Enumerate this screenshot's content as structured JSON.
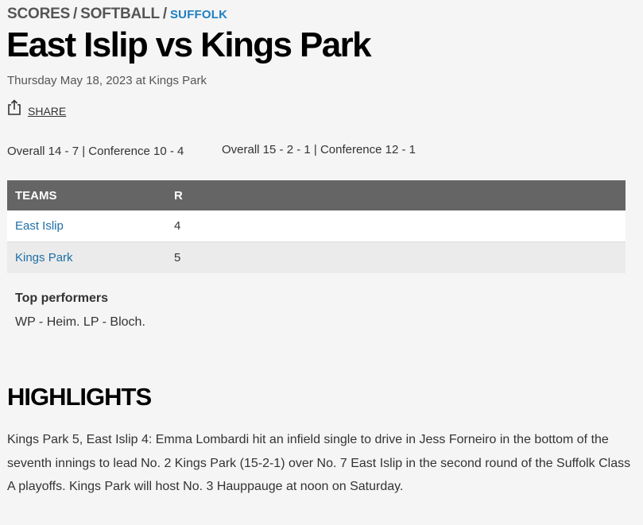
{
  "breadcrumb": {
    "scores": "SCORES",
    "sep1": "/",
    "softball": "SOFTBALL",
    "sep2": "/",
    "suffolk": "SUFFOLK"
  },
  "game": {
    "title": "East Islip vs Kings Park",
    "date": "Thursday May 18, 2023 at Kings Park"
  },
  "share": {
    "label": "SHARE",
    "icon": "share-icon"
  },
  "records": {
    "team1": "Overall 14 - 7 | Conference 10 - 4",
    "team2": "Overall 15 - 2 - 1 | Conference 12 - 1"
  },
  "scoreboard": {
    "headers": [
      "TEAMS",
      "R"
    ],
    "rows": [
      {
        "team": "East Islip",
        "runs": "4"
      },
      {
        "team": "Kings Park",
        "runs": "5"
      }
    ]
  },
  "top_performers": {
    "heading": "Top performers",
    "text": "WP - Heim. LP - Bloch."
  },
  "highlights": {
    "heading": "HIGHLIGHTS",
    "text": "Kings Park 5, East Islip 4: Emma Lombardi hit an infield single to drive in Jess Forneiro in the bottom of the seventh innings to lead No. 2 Kings Park (15-2-1) over No. 7 East Islip in the second round of the Suffolk Class A playoffs. Kings Park will host No. 3 Hauppauge at noon on Saturday."
  },
  "colors": {
    "link": "#1e7fc2",
    "table_header": "#656565",
    "background": "#f5f5f5"
  }
}
